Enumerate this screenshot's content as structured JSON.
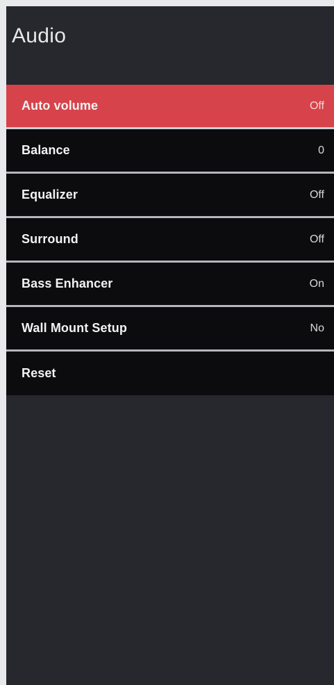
{
  "header": {
    "title": "Audio"
  },
  "menu": {
    "items": [
      {
        "label": "Auto volume",
        "value": "Off",
        "selected": true
      },
      {
        "label": "Balance",
        "value": "0",
        "selected": false
      },
      {
        "label": "Equalizer",
        "value": "Off",
        "selected": false
      },
      {
        "label": "Surround",
        "value": "Off",
        "selected": false
      },
      {
        "label": "Bass Enhancer",
        "value": "On",
        "selected": false
      },
      {
        "label": "Wall Mount Setup",
        "value": "No",
        "selected": false
      },
      {
        "label": "Reset",
        "value": "",
        "selected": false
      }
    ]
  },
  "colors": {
    "background": "#26282e",
    "item_background": "#0c0c0e",
    "selected_background": "#d7434b",
    "divider": "#b5b7bc",
    "text": "#f2f2f2"
  }
}
